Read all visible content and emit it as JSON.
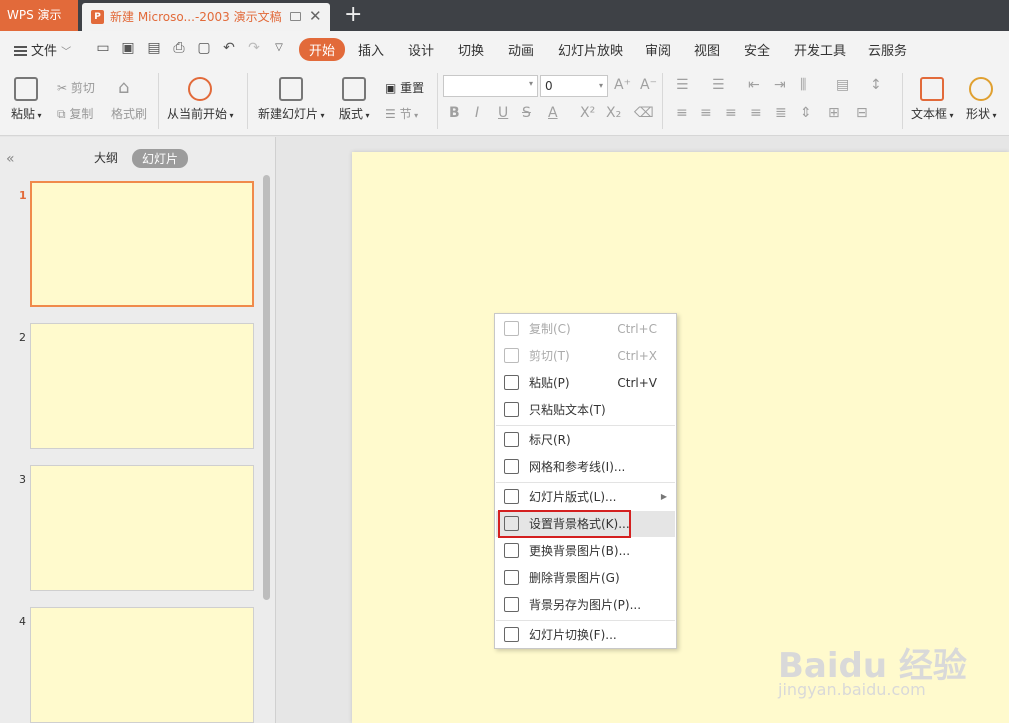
{
  "titlebar": {
    "app_name": "WPS 演示",
    "doc_title": "新建 Microso...-2003 演示文稿",
    "new_tab": "+"
  },
  "menubar": {
    "file_label": "文件",
    "tabs": [
      {
        "label": "开始",
        "active": true
      },
      {
        "label": "插入"
      },
      {
        "label": "设计"
      },
      {
        "label": "切换"
      },
      {
        "label": "动画"
      },
      {
        "label": "幻灯片放映"
      },
      {
        "label": "审阅"
      },
      {
        "label": "视图"
      },
      {
        "label": "安全"
      },
      {
        "label": "开发工具"
      },
      {
        "label": "云服务"
      }
    ]
  },
  "ribbon": {
    "paste": "粘贴",
    "cut": "剪切",
    "copy": "复制",
    "format_painter": "格式刷",
    "from_current": "从当前开始",
    "new_slide": "新建幻灯片",
    "layout": "版式",
    "reset": "重置",
    "section": "节",
    "font_size": "0",
    "text_box": "文本框",
    "shape": "形状"
  },
  "leftpane": {
    "outline_tab": "大纲",
    "slides_tab": "幻灯片",
    "slide_numbers": [
      "1",
      "2",
      "3",
      "4"
    ]
  },
  "context_menu": {
    "items": [
      {
        "label": "复制(C)",
        "shortcut": "Ctrl+C",
        "disabled": true,
        "icon": "copy-icon"
      },
      {
        "label": "剪切(T)",
        "shortcut": "Ctrl+X",
        "disabled": true,
        "icon": "cut-icon"
      },
      {
        "label": "粘贴(P)",
        "shortcut": "Ctrl+V",
        "icon": "paste-icon"
      },
      {
        "label": "只粘贴文本(T)",
        "icon": "paste-text-icon"
      },
      {
        "label": "标尺(R)",
        "icon": "ruler-icon"
      },
      {
        "label": "网格和参考线(I)...",
        "icon": "grid-icon"
      },
      {
        "label": "幻灯片版式(L)...",
        "submenu": true,
        "icon": "slide-layout-icon"
      },
      {
        "label": "设置背景格式(K)...",
        "highlighted": true,
        "icon": "background-format-icon"
      },
      {
        "label": "更换背景图片(B)...",
        "icon": "change-background-icon"
      },
      {
        "label": "删除背景图片(G)",
        "icon": "delete-background-icon"
      },
      {
        "label": "背景另存为图片(P)...",
        "icon": "save-background-icon"
      },
      {
        "label": "幻灯片切换(F)...",
        "icon": "slide-transition-icon"
      }
    ]
  },
  "watermark": {
    "brand": "Baidu 经验",
    "url": "jingyan.baidu.com"
  },
  "colors": {
    "accent": "#e26a3a",
    "slide_bg": "#fffacd",
    "highlight_frame": "#d42020"
  }
}
